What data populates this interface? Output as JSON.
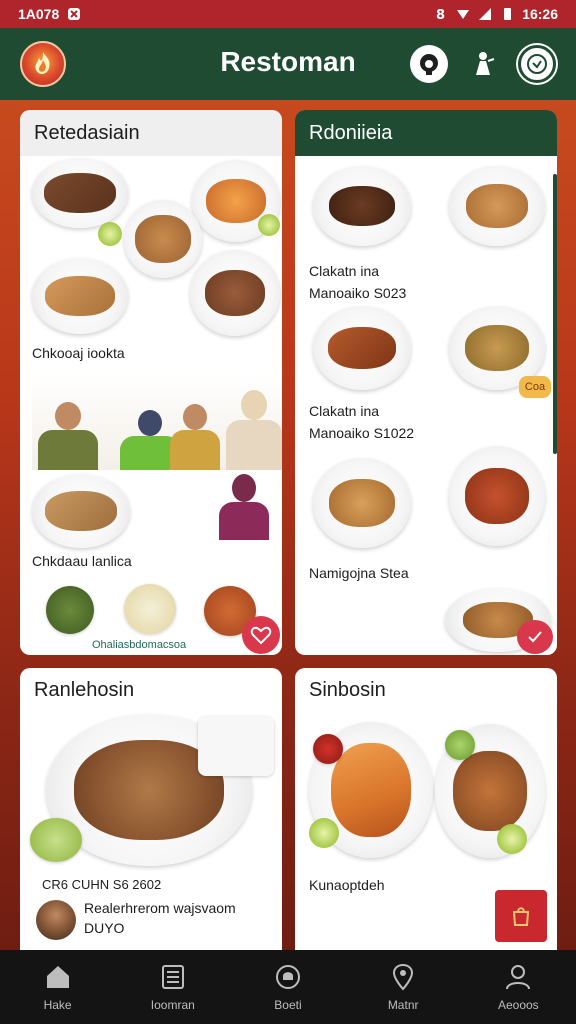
{
  "status": {
    "time_left": "1A078",
    "time_right": "16:26"
  },
  "app": {
    "title": "Restoman"
  },
  "cards": {
    "card1": {
      "title": "Retedasiain",
      "caption1": "Chkooaj iookta",
      "caption2": "Chkdaau lanlica",
      "footer": "Ohaliasbdomacsoa"
    },
    "card2": {
      "title": "Rdoniieia",
      "caption1_line1": "Clakatn ina",
      "caption1_line2": "Manoaiko S023",
      "badge": "Coa",
      "caption2_line1": "Clakatn ina",
      "caption2_line2": "Manoaiko S1022",
      "caption3": "Namigojna Stea"
    },
    "card3": {
      "title": "Ranlehosin",
      "price": "CR6 CUHN S6 2602",
      "review_line1": "Realerhrerom wajsvaom",
      "review_line2": "DUYO"
    },
    "card4": {
      "title": "Sinbosin",
      "caption": "Kunaoptdeh"
    }
  },
  "nav": {
    "home": "Hake",
    "restaurants": "Ioomran",
    "orders": "Boeti",
    "map": "Matnr",
    "profile": "Aeooos"
  },
  "colors": {
    "primary_green": "#1f4b32",
    "accent_red": "#d9374c",
    "status_red": "#b0242b"
  }
}
